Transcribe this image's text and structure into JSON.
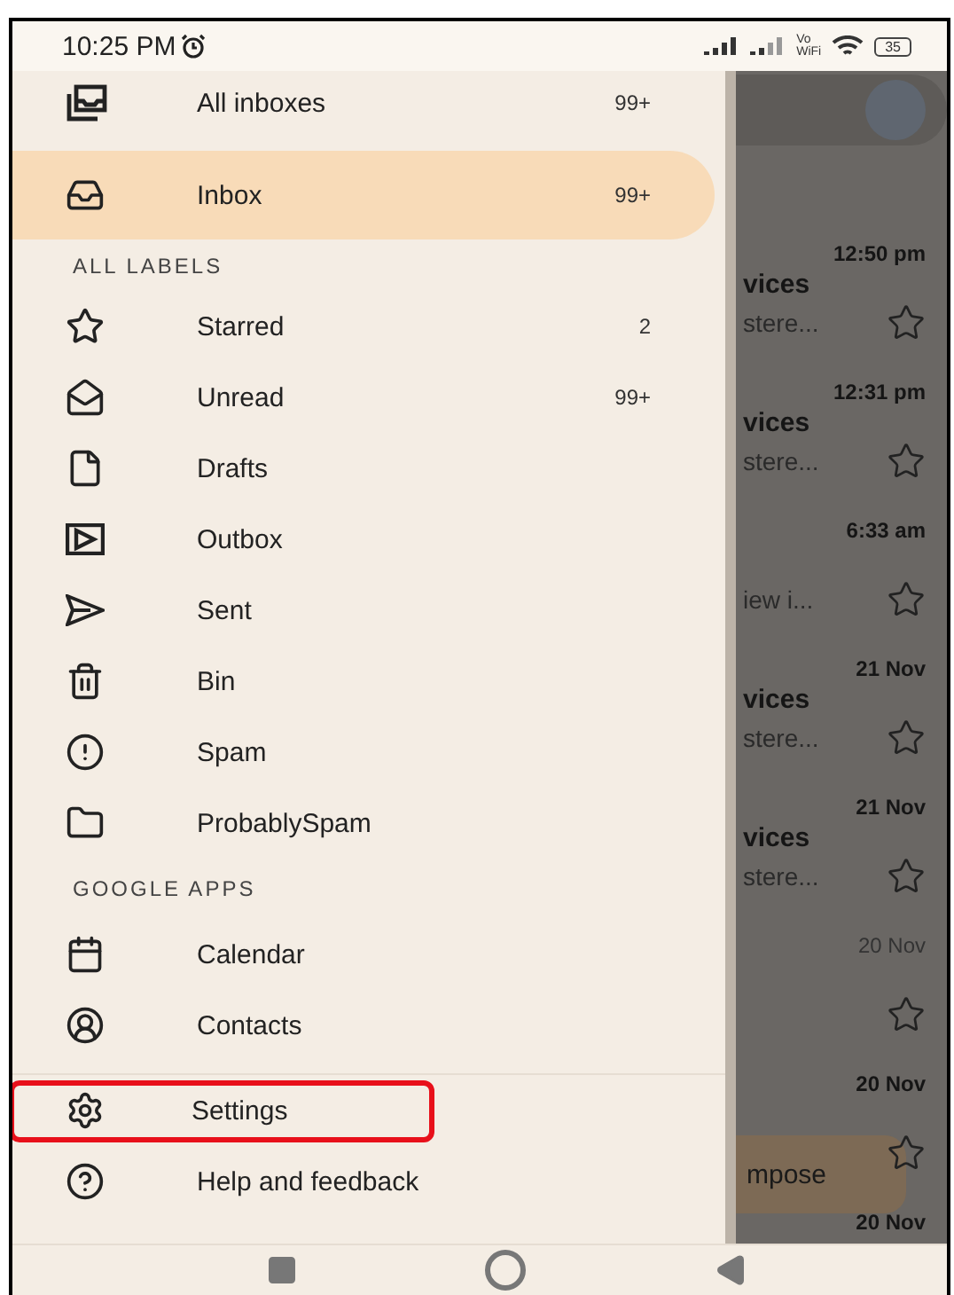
{
  "status_bar": {
    "time": "10:25 PM",
    "vowifi": [
      "Vo",
      "WiFi"
    ],
    "battery": "35"
  },
  "drawer": {
    "sections": [
      {
        "items": [
          {
            "label": "All inboxes",
            "count": "99+",
            "selected": false,
            "highlighted": false
          },
          {
            "label": "Inbox",
            "count": "99+",
            "selected": true,
            "highlighted": false
          }
        ]
      },
      {
        "heading": "ALL LABELS",
        "items": [
          {
            "label": "Starred",
            "count": "2",
            "selected": false,
            "highlighted": false
          },
          {
            "label": "Unread",
            "count": "99+",
            "selected": false,
            "highlighted": false
          },
          {
            "label": "Drafts",
            "selected": false,
            "highlighted": false
          },
          {
            "label": "Outbox",
            "selected": false,
            "highlighted": false
          },
          {
            "label": "Sent",
            "selected": false,
            "highlighted": false
          },
          {
            "label": "Bin",
            "selected": false,
            "highlighted": false
          },
          {
            "label": "Spam",
            "selected": false,
            "highlighted": false
          },
          {
            "label": "ProbablySpam",
            "selected": false,
            "highlighted": false
          }
        ]
      },
      {
        "heading": "GOOGLE APPS",
        "items": [
          {
            "label": "Calendar",
            "selected": false,
            "highlighted": false
          },
          {
            "label": "Contacts",
            "selected": false,
            "highlighted": false
          }
        ]
      },
      {
        "items": [
          {
            "label": "Settings",
            "selected": false,
            "highlighted": true
          },
          {
            "label": "Help and feedback",
            "selected": false,
            "highlighted": false
          }
        ]
      }
    ]
  },
  "emails": [
    {
      "time": "12:50 pm",
      "sender": "vices",
      "snippet": "stere...",
      "unread": true
    },
    {
      "time": "12:31 pm",
      "sender": "vices",
      "snippet": "stere...",
      "unread": true
    },
    {
      "time": "6:33 am",
      "snippet": "iew i...",
      "unread": true
    },
    {
      "time": "21 Nov",
      "sender": "vices",
      "snippet": "stere...",
      "unread": true
    },
    {
      "time": "21 Nov",
      "sender": "vices",
      "snippet": "stere...",
      "unread": true
    },
    {
      "time": "20 Nov",
      "unread": false
    },
    {
      "time": "20 Nov",
      "unread": true
    },
    {
      "time": "20 Nov",
      "unread": true
    }
  ],
  "compose": {
    "label": "mpose"
  }
}
